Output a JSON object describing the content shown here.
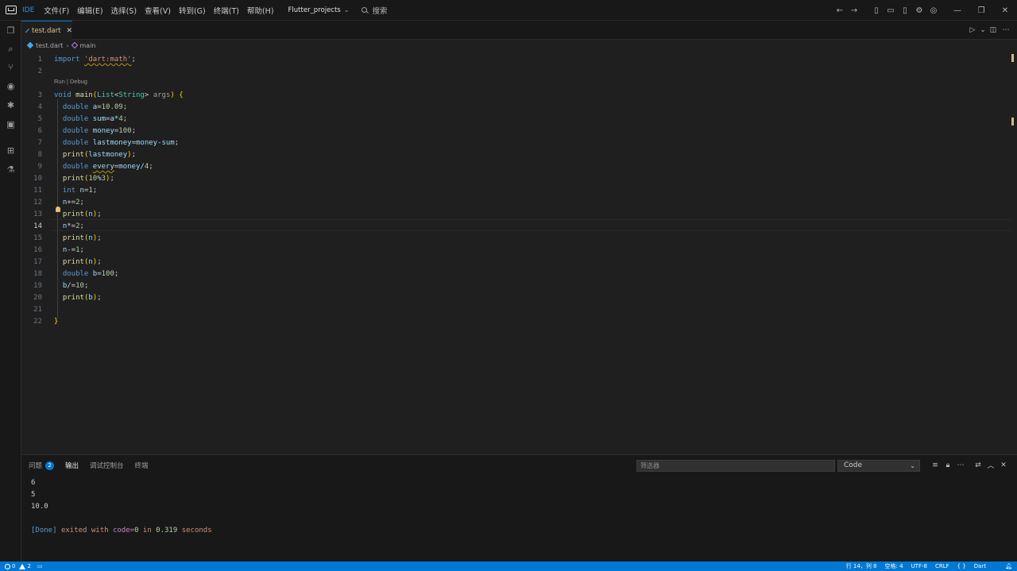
{
  "titlebar": {
    "ide_tag": "IDE",
    "menu": [
      "文件(F)",
      "编辑(E)",
      "选择(S)",
      "查看(V)",
      "转到(G)",
      "终端(T)",
      "帮助(H)"
    ],
    "project": "Flutter_projects",
    "search_placeholder": "搜索"
  },
  "editor": {
    "tab_label": "test.dart",
    "breadcrumb": {
      "file": "test.dart",
      "symbol": "main"
    },
    "codelens": "Run | Debug",
    "line_numbers": [
      "1",
      "2",
      "3",
      "4",
      "5",
      "6",
      "7",
      "8",
      "9",
      "10",
      "11",
      "12",
      "13",
      "14",
      "15",
      "16",
      "17",
      "18",
      "19",
      "20",
      "21",
      "22"
    ],
    "active_line": 14,
    "code": {
      "l1": {
        "kw": "import",
        "str": "'dart:math'",
        "end": ";"
      },
      "l3": {
        "kw": "void",
        "fn": "main",
        "ty1": "List",
        "ty2": "String",
        "prm": "args"
      },
      "l4": {
        "kw": "double",
        "var": "a",
        "num": "10.09"
      },
      "l5": {
        "kw": "double",
        "var": "sum",
        "rest": "a*",
        "num": "4"
      },
      "l6": {
        "kw": "double",
        "var": "money",
        "num": "100"
      },
      "l7": {
        "kw": "double",
        "var": "lastmoney",
        "rest": "money-sum"
      },
      "l8": {
        "fn": "print",
        "var": "lastmoney"
      },
      "l9": {
        "kw": "double",
        "var": "every",
        "rest": "money/",
        "num": "4"
      },
      "l10": {
        "fn": "print",
        "num1": "10",
        "op": "%",
        "num2": "3"
      },
      "l11": {
        "kw": "int",
        "var": "n",
        "num": "1"
      },
      "l12": {
        "var": "n",
        "op": "+=",
        "num": "2"
      },
      "l13": {
        "fn": "print",
        "var": "n"
      },
      "l14": {
        "var": "n",
        "op": "*=",
        "num": "2"
      },
      "l15": {
        "fn": "print",
        "var": "n"
      },
      "l16": {
        "var": "n",
        "op": "-=",
        "num": "1"
      },
      "l17": {
        "fn": "print",
        "var": "n"
      },
      "l18": {
        "kw": "double",
        "var": "b",
        "num": "100"
      },
      "l19": {
        "var": "b",
        "op": "/=",
        "num": "10"
      },
      "l20": {
        "fn": "print",
        "var": "b"
      }
    }
  },
  "panel": {
    "tabs": [
      "问题",
      "输出",
      "调试控制台",
      "终端"
    ],
    "problems_count": "2",
    "active_tab": "输出",
    "filter_placeholder": "筛选器",
    "channel": "Code",
    "output_lines": [
      "6",
      "5",
      "10.0"
    ],
    "done": {
      "tag": "[Done]",
      "text1": "exited with",
      "code_label": "code=",
      "code_value": "0",
      "text2": "in",
      "time": "0.319",
      "unit": "seconds"
    }
  },
  "statusbar": {
    "errors": "0",
    "warnings": "2",
    "position": "行 14，列 8",
    "spaces": "空格: 4",
    "encoding": "UTF-8",
    "eol": "CRLF",
    "braces": "{ }",
    "language": "Dart"
  },
  "colors": {
    "accent": "#0078d4",
    "background": "#1f1f1f",
    "keyword": "#569cd6",
    "string": "#ce9178"
  }
}
